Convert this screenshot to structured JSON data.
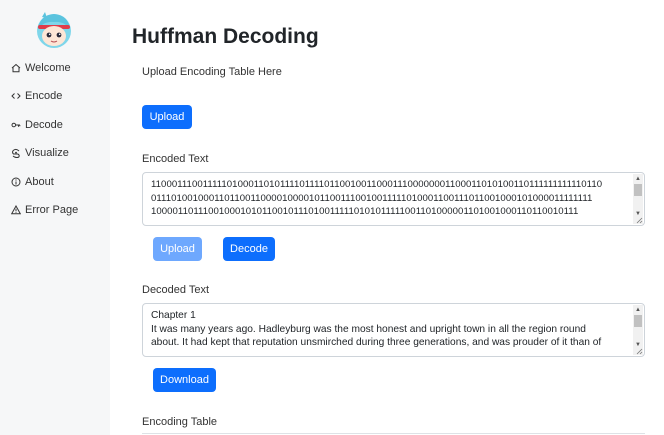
{
  "sidebar": {
    "items": [
      {
        "label": "Welcome",
        "icon": "home-icon"
      },
      {
        "label": "Encode",
        "icon": "code-icon"
      },
      {
        "label": "Decode",
        "icon": "key-icon"
      },
      {
        "label": "Visualize",
        "icon": "visualize-icon"
      },
      {
        "label": "About",
        "icon": "info-icon"
      },
      {
        "label": "Error Page",
        "icon": "warning-icon"
      }
    ]
  },
  "main": {
    "title": "Huffman Decoding",
    "upload_table_label": "Upload Encoding Table Here",
    "upload_table_button": "Upload",
    "encoded_label": "Encoded Text",
    "encoded_lines": [
      "1100011100111110100011010111101111011001001100011100000001100011010100110111111111110110",
      "0111010010001101100110000100001011001110010011111010001100111011001000101000011111111",
      "1000011011100100010101100101110100111110101011111001101000001101001000110110010111"
    ],
    "upload_encoded_button": "Upload",
    "decode_button": "Decode",
    "decoded_label": "Decoded Text",
    "decoded_lines": [
      "Chapter 1",
      "It was many years ago. Hadleyburg was the most honest and upright town in all the region round",
      "about. It had kept that reputation unsmirched during three generations, and was prouder of it than of"
    ],
    "download_button": "Download",
    "encoding_table_label": "Encoding Table"
  },
  "colors": {
    "primary": "#0d6efd",
    "primary_disabled": "#6ea8fe",
    "sidebar_bg": "#f6f7f8"
  }
}
